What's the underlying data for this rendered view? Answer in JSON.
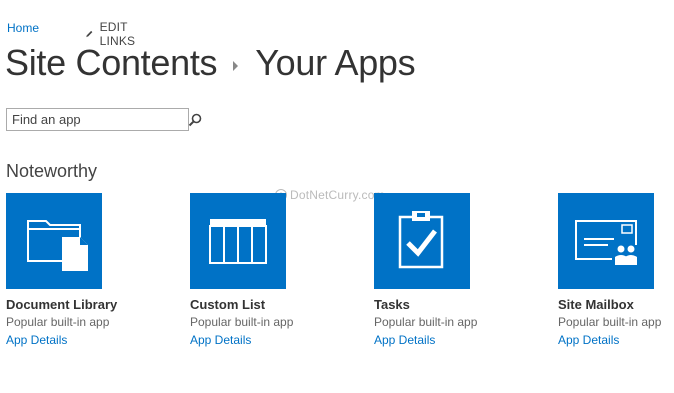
{
  "nav": {
    "home": "Home",
    "edit_links": "EDIT LINKS"
  },
  "title": {
    "part1": "Site Contents",
    "part2": "Your Apps"
  },
  "search": {
    "placeholder": "Find an app"
  },
  "section": {
    "heading": "Noteworthy"
  },
  "watermark": "DotNetCurry.com",
  "apps": [
    {
      "name": "Document Library",
      "description": "Popular built-in app",
      "details": "App Details",
      "icon": "document-library-icon"
    },
    {
      "name": "Custom List",
      "description": "Popular built-in app",
      "details": "App Details",
      "icon": "custom-list-icon"
    },
    {
      "name": "Tasks",
      "description": "Popular built-in app",
      "details": "App Details",
      "icon": "tasks-icon"
    },
    {
      "name": "Site Mailbox",
      "description": "Popular built-in app",
      "details": "App Details",
      "icon": "site-mailbox-icon"
    }
  ],
  "colors": {
    "tile": "#0072c6",
    "link": "#0072c6"
  }
}
